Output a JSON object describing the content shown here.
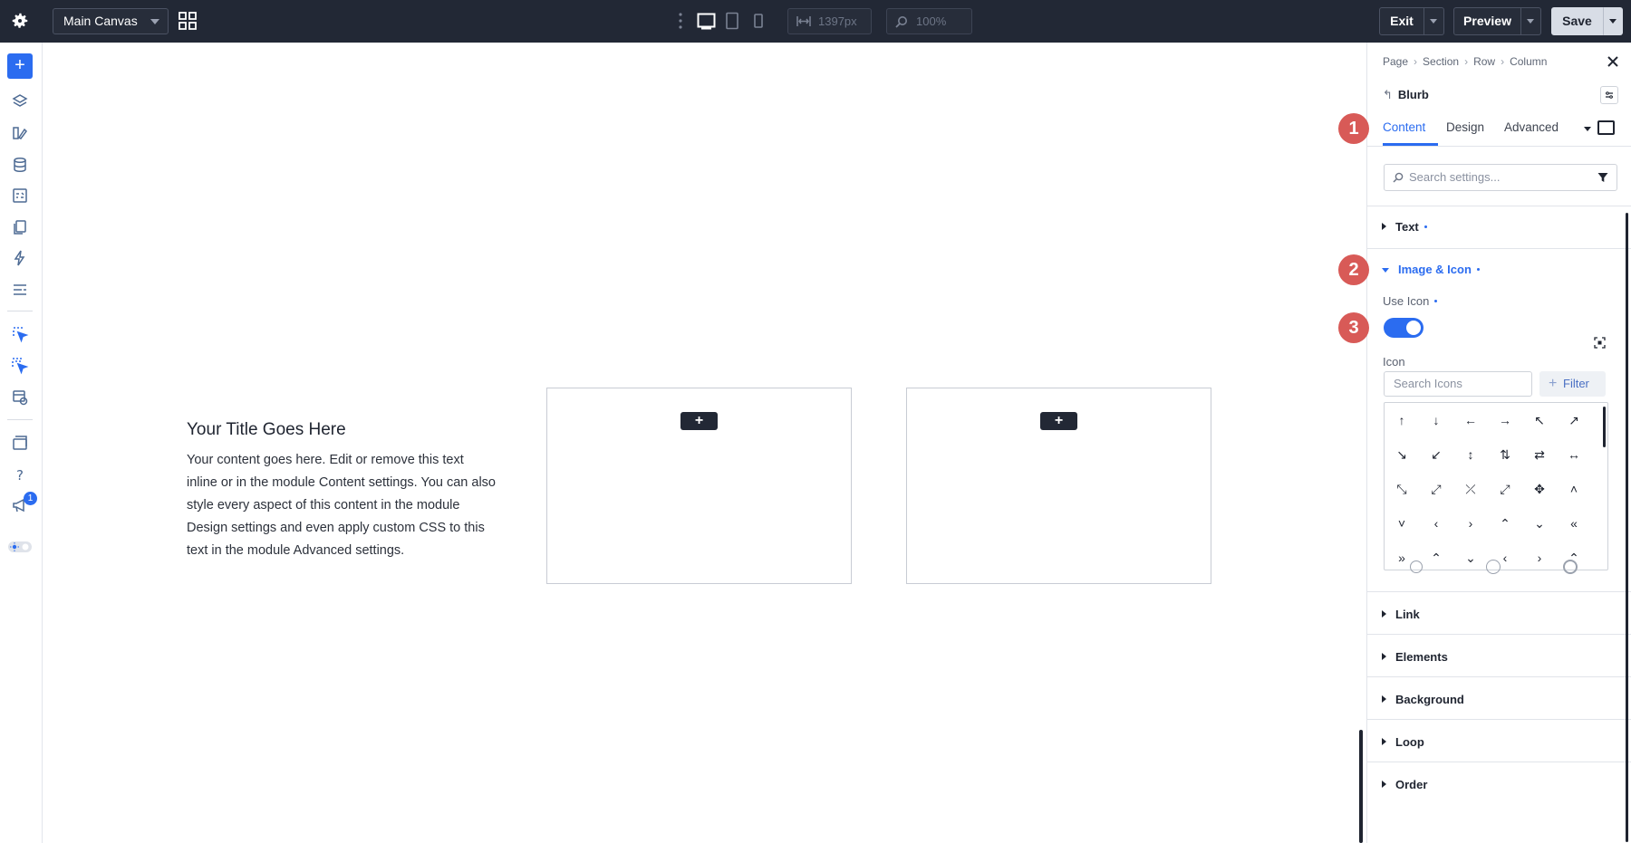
{
  "topbar": {
    "canvas_select": "Main Canvas",
    "width_value": "1397px",
    "zoom_value": "100%",
    "exit_label": "Exit",
    "preview_label": "Preview",
    "save_label": "Save"
  },
  "leftbar": {
    "add_label": "+",
    "notification_count": "1"
  },
  "canvas": {
    "blurb_title": "Your Title Goes Here",
    "blurb_body": "Your content goes here. Edit or remove this text inline or in the module Content settings. You can also style every aspect of this content in the module Design settings and even apply custom CSS to this text in the module Advanced settings.",
    "add_module_label": "+"
  },
  "panel": {
    "breadcrumb": [
      "Page",
      "Section",
      "Row",
      "Column"
    ],
    "breadcrumb_sep": "›",
    "module_title": "Blurb",
    "back_glyph": "↰",
    "tabs": [
      "Content",
      "Design",
      "Advanced"
    ],
    "search_placeholder": "Search settings...",
    "groups": {
      "text": "Text",
      "image_icon": "Image & Icon",
      "link": "Link",
      "elements": "Elements",
      "background": "Background",
      "loop": "Loop",
      "order": "Order"
    },
    "use_icon_label": "Use Icon",
    "use_icon_enabled": true,
    "icon_label": "Icon",
    "icon_search_placeholder": "Search Icons",
    "filter_label": "Filter",
    "filter_plus": "+",
    "icons": [
      "↑",
      "↓",
      "←",
      "→",
      "↖",
      "↗",
      "↘",
      "↙",
      "↕",
      "⇅",
      "⇄",
      "↔",
      "⤡",
      "⤢",
      "⤫",
      "⤢",
      "✥",
      "˄",
      "˅",
      "‹",
      "›",
      "⌃",
      "⌄",
      "«",
      "»",
      "⌃",
      "⌄",
      "‹",
      "›",
      "⌃"
    ]
  },
  "callouts": [
    "1",
    "2",
    "3"
  ],
  "colors": {
    "accent": "#2b6cf0",
    "callout": "#d85a57",
    "topbar": "#222835"
  }
}
